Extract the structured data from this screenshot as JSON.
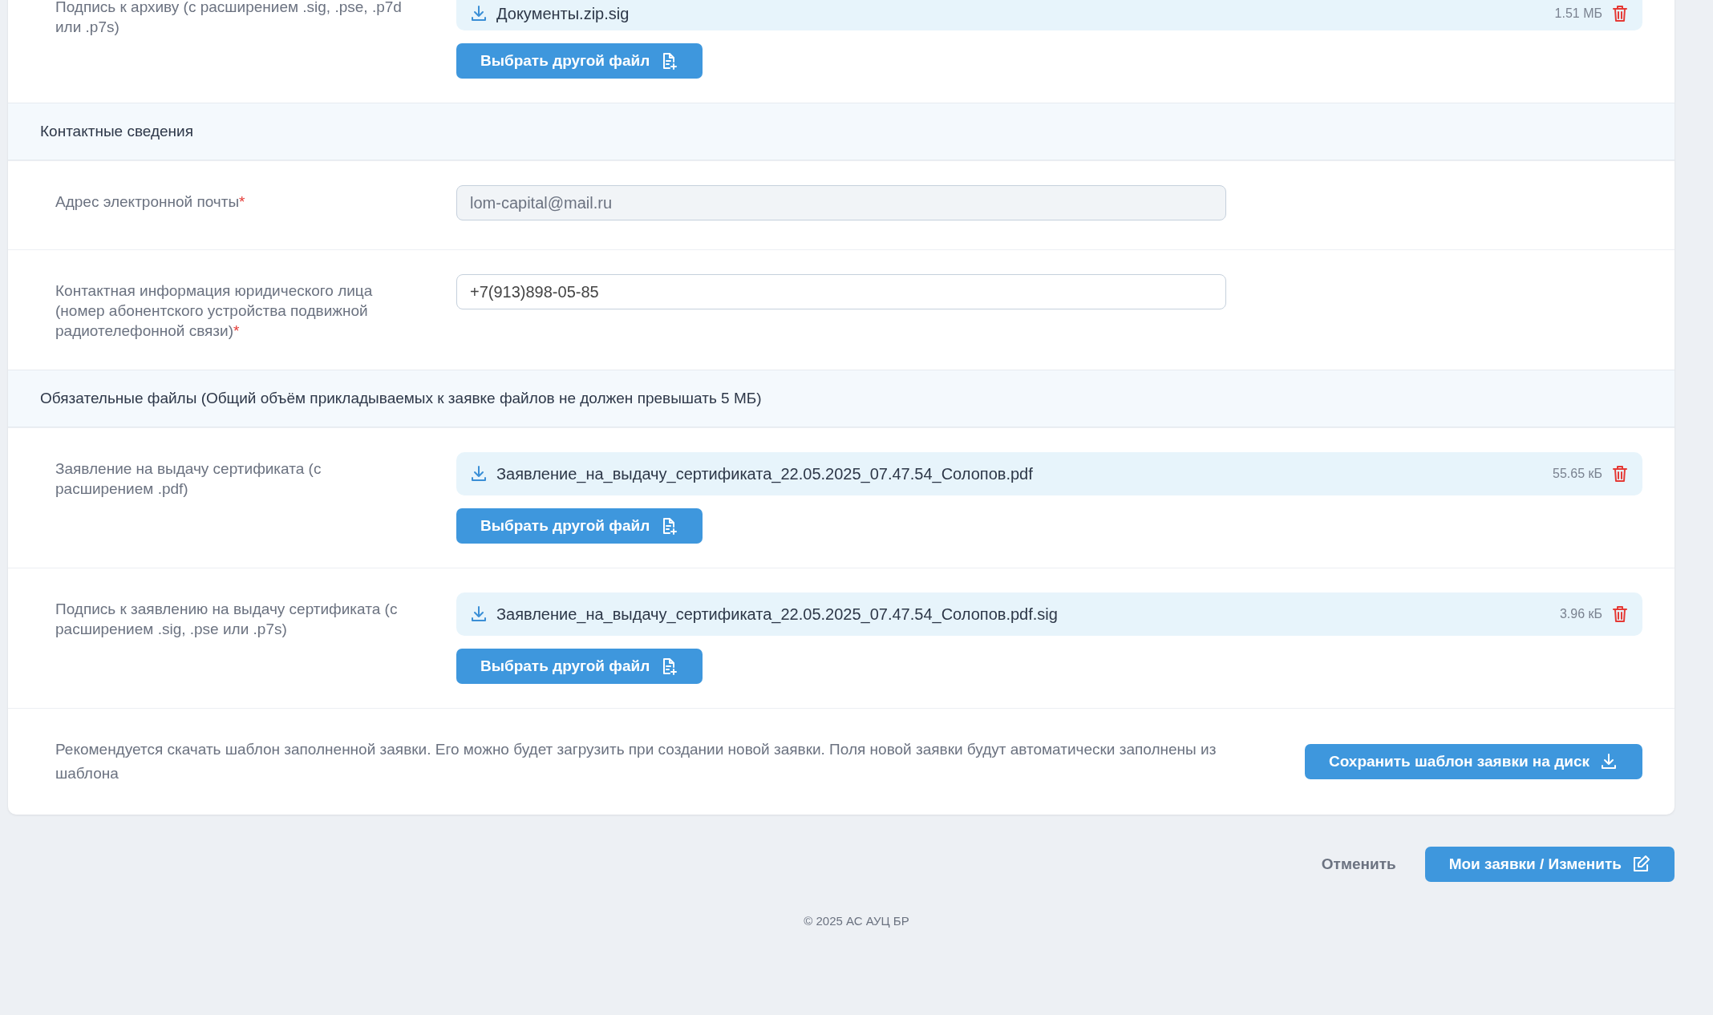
{
  "rows": [
    {
      "kind": "file",
      "label": "Подпись к архиву (с расширением .sig, .pse, .p7d или .p7s)",
      "file_name": "Документы.zip.sig",
      "size": "1.51 МБ",
      "button": "Выбрать другой файл"
    },
    {
      "kind": "header",
      "title": "Контактные сведения"
    },
    {
      "kind": "input",
      "label": "Адрес электронной почты",
      "required_mark": "*",
      "value": "lom-capital@mail.ru",
      "disabled": true
    },
    {
      "kind": "input",
      "label": "Контактная информация юридического лица (номер абонентского устройства подвижной радиотелефонной связи)",
      "required_mark": "*",
      "value": "+7(913)898-05-85",
      "disabled": false
    },
    {
      "kind": "header",
      "title": "Обязательные файлы (Общий объём прикладываемых к заявке файлов не должен превышать 5 МБ)"
    },
    {
      "kind": "file",
      "label": "Заявление на выдачу сертификата (с расширением .pdf)",
      "file_name": "Заявление_на_выдачу_сертификата_22.05.2025_07.47.54_Солопов.pdf",
      "size": "55.65 кБ",
      "button": "Выбрать другой файл"
    },
    {
      "kind": "file",
      "label": "Подпись к заявлению на выдачу сертификата (с расширением .sig, .pse или .p7s)",
      "file_name": "Заявление_на_выдачу_сертификата_22.05.2025_07.47.54_Солопов.pdf.sig",
      "size": "3.96 кБ",
      "button": "Выбрать другой файл"
    },
    {
      "kind": "recommendation",
      "text": "Рекомендуется скачать шаблон заполненной заявки. Его можно будет загрузить при создании новой заявки. Поля новой заявки будут автоматически заполнены из шаблона",
      "button": "Сохранить шаблон заявки на диск"
    }
  ],
  "footer": {
    "cancel": "Отменить",
    "submit": "Мои заявки / Изменить",
    "copyright": "© 2025 АС АУЦ БР"
  }
}
